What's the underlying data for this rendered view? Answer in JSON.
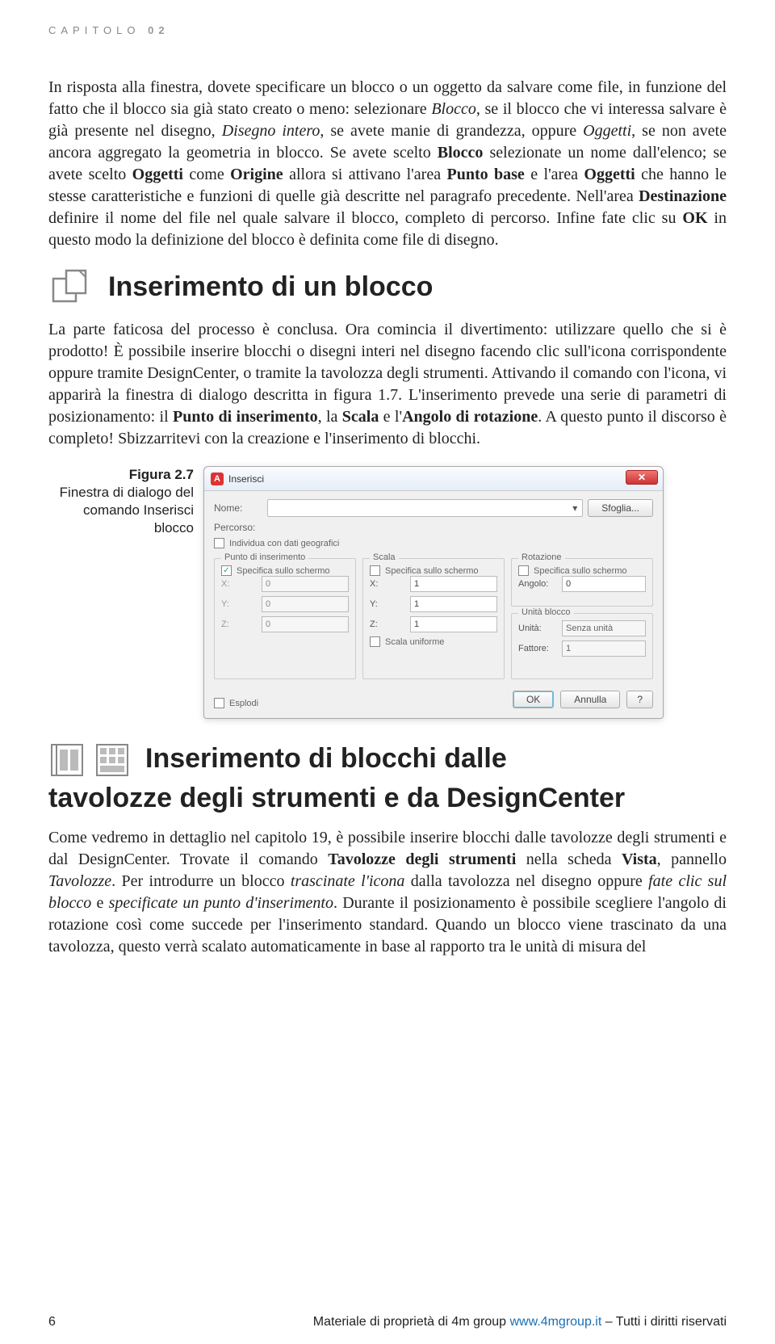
{
  "chapter": {
    "label": "CAPITOLO",
    "number": "02"
  },
  "paragraph1_html": "In risposta alla finestra, dovete specificare un blocco o un oggetto da salvare come file, in funzione del fatto che il blocco sia già stato creato o meno: selezionare <i>Blocco</i>, se il blocco che vi interessa salvare è già presente nel disegno, <i>Disegno intero</i>, se avete manie di grandezza, oppure <i>Oggetti</i>, se non avete ancora aggregato la geometria in blocco. Se avete scelto <b>Blocco</b> selezionate un nome dall'elenco; se avete scelto <b>Oggetti</b> come <b>Origine</b> allora si attivano l'area <b>Punto base</b> e l'area <b>Oggetti</b> che hanno le stesse caratteristiche e funzioni di quelle già descritte nel paragrafo precedente. Nell'area <b>Destinazione</b> definire il nome del file nel quale salvare il blocco, completo di percorso. Infine fate clic su <b>OK</b> in questo modo la definizione del blocco è definita come file di disegno.",
  "section1": {
    "title": "Inserimento di un blocco"
  },
  "paragraph2_html": "La parte faticosa del processo è conclusa. Ora comincia il divertimento: utilizzare quello che si è prodotto! È possibile inserire blocchi o disegni interi nel disegno facendo clic sull'icona corrispondente oppure tramite DesignCenter, o tramite la tavolozza degli strumenti. Attivando il comando con l'icona, vi apparirà la finestra di dialogo descritta in figura 1.7. L'inserimento prevede una serie di parametri di posizionamento: il <b>Punto di inserimento</b>, la <b>Scala</b> e l'<b>Angolo di rotazione</b>. A questo punto il discorso è completo! Sbizzarritevi con la creazione e l'inserimento di blocchi.",
  "figure": {
    "label": "Figura 2.7",
    "caption": "Finestra di dialogo del comando Inserisci blocco"
  },
  "dialog": {
    "title": "Inserisci",
    "nome_label": "Nome:",
    "sfoglia": "Sfoglia...",
    "percorso_label": "Percorso:",
    "geodata_label": "Individua con dati geografici",
    "group_insert": "Punto di inserimento",
    "group_scale": "Scala",
    "group_rot": "Rotazione",
    "group_units": "Unità blocco",
    "specify": "Specifica sullo schermo",
    "x": "X:",
    "y": "Y:",
    "z": "Z:",
    "v0": "0",
    "v1": "1",
    "angle_label": "Angolo:",
    "angle_val": "0",
    "unita_label": "Unità:",
    "unita_val": "Senza unità",
    "fattore_label": "Fattore:",
    "fattore_val": "1",
    "scale_uniform": "Scala uniforme",
    "esplodi": "Esplodi",
    "ok": "OK",
    "annulla": "Annulla",
    "help": "?"
  },
  "section2": {
    "title_line1": "Inserimento di blocchi dalle",
    "title_line2": "tavolozze degli strumenti e da DesignCenter"
  },
  "paragraph3_html": "Come vedremo in dettaglio nel capitolo 19, è possibile inserire blocchi dalle tavolozze degli strumenti e dal DesignCenter. Trovate il comando <b>Tavolozze degli strumenti</b> nella scheda <b>Vista</b>, pannello <i>Tavolozze</i>. Per introdurre un blocco <i>trascinate l'icona</i> dalla tavolozza nel disegno oppure <i>fate clic sul blocco</i> e <i>specificate un punto d'inserimento</i>. Durante il posizionamento è possibile scegliere l'angolo di rotazione così come succede per l'inserimento standard. Quando un blocco viene trascinato da una tavolozza, questo verrà scalato automaticamente in base al rapporto tra le unità di misura del",
  "footer": {
    "page": "6",
    "text1": "Materiale di proprietà di 4m group ",
    "link": "www.4mgroup.it",
    "text2": " – Tutti i diritti riservati"
  }
}
